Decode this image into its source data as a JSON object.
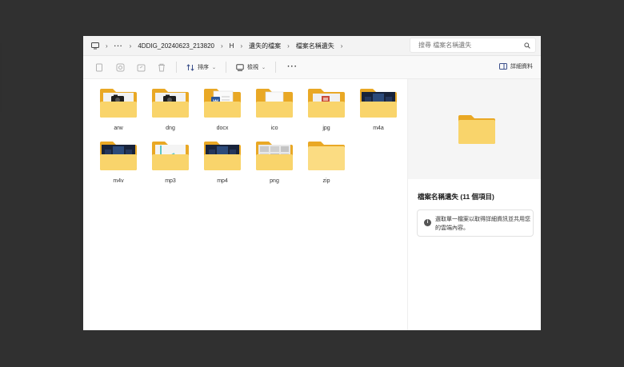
{
  "address_bar": {
    "breadcrumbs": [
      "4DDIG_20240623_213820",
      "H",
      "遺失的檔案",
      "檔案名稱遺失"
    ],
    "overflow": "···",
    "search_placeholder": "搜尋 檔案名稱遺失"
  },
  "toolbar": {
    "sort_label": "排序",
    "view_label": "檢視",
    "more": "···",
    "details_label": "詳細資料"
  },
  "folders": [
    {
      "name": "arw",
      "thumb": "camera"
    },
    {
      "name": "dng",
      "thumb": "camera"
    },
    {
      "name": "docx",
      "thumb": "word"
    },
    {
      "name": "ico",
      "thumb": "blank"
    },
    {
      "name": "jpg",
      "thumb": "photo"
    },
    {
      "name": "m4a",
      "thumb": "dark"
    },
    {
      "name": "m4v",
      "thumb": "dark"
    },
    {
      "name": "mp3",
      "thumb": "play"
    },
    {
      "name": "mp4",
      "thumb": "dark"
    },
    {
      "name": "png",
      "thumb": "screenshot"
    },
    {
      "name": "zip",
      "thumb": "none"
    }
  ],
  "details_pane": {
    "title": "檔案名稱遺失 (11 個項目)",
    "info_icon": "i",
    "info_text": "選取單一檔案以取得詳細資訊並共用您的雲端內容。"
  },
  "colors": {
    "folder_back": "#e9a825",
    "folder_front": "#f9d46b",
    "folder_front_light": "#fbdc82",
    "background": "#303030",
    "window": "#ffffff"
  }
}
